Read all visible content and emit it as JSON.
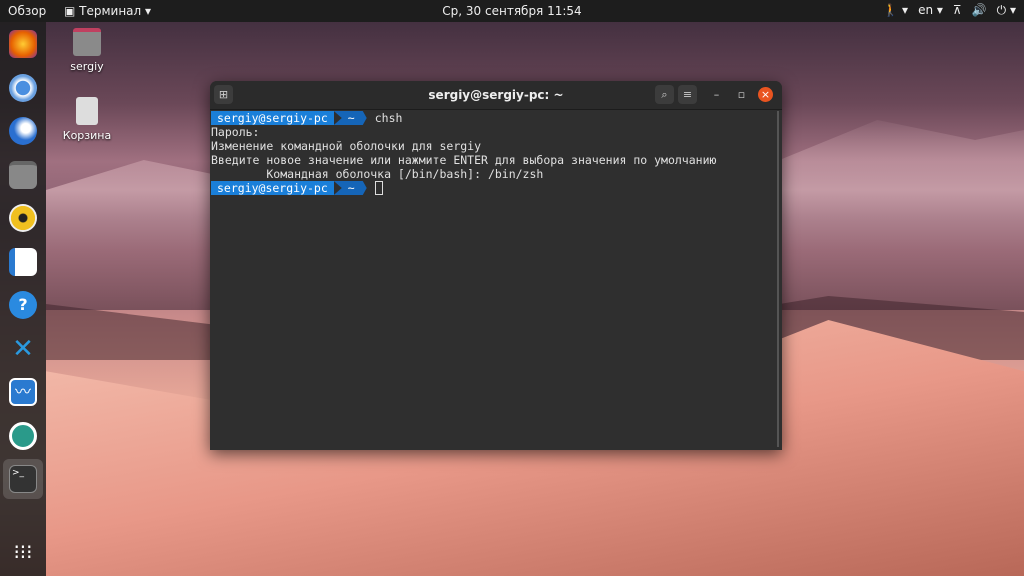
{
  "topbar": {
    "overview": "Обзор",
    "app": "Терминал ▾",
    "clock": "Ср, 30 сентября  11:54",
    "accessibility": "🚶 ▾",
    "lang": "en ▾",
    "network": "⊼",
    "volume": "🔊",
    "power": "⏻ ▾"
  },
  "desktop": {
    "home": "sergiy",
    "trash": "Корзина"
  },
  "dock": [
    "firefox",
    "chromium",
    "thunderbird",
    "files",
    "rhythmbox",
    "libreoffice-writer",
    "help",
    "vscode",
    "system-monitor",
    "remmina",
    "terminal",
    "show-apps"
  ],
  "window": {
    "title": "sergiy@sergiy-pc: ~",
    "new_tab": "⊞",
    "search": "⌕",
    "menu": "≡",
    "minimize": "–",
    "maximize": "▫",
    "close": "×"
  },
  "terminal": {
    "user": "sergiy@sergiy-pc",
    "dir": "~",
    "cmd": "chsh",
    "lines": [
      "Пароль:",
      "Изменение командной оболочки для sergiy",
      "Введите новое значение или нажмите ENTER для выбора значения по умолчанию",
      "        Командная оболочка [/bin/bash]: /bin/zsh"
    ]
  }
}
